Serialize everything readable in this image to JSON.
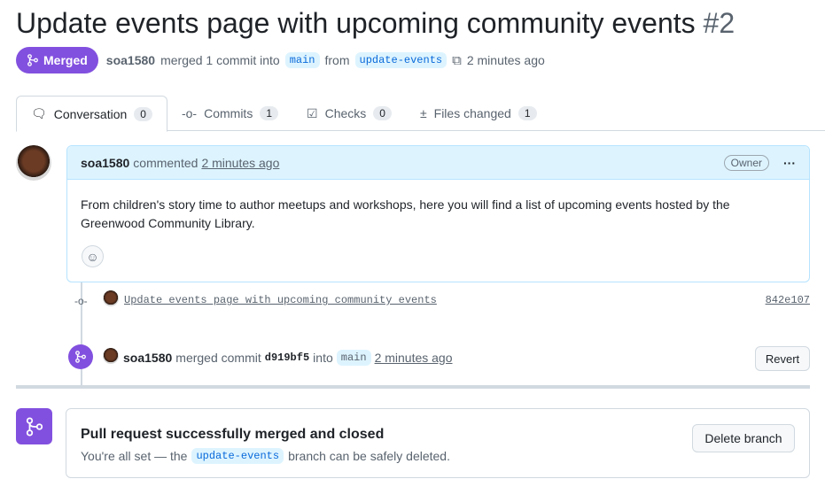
{
  "pr": {
    "title": "Update events page with upcoming community events",
    "number": "#2",
    "state": "Merged",
    "author": "soa1580",
    "summary": "merged 1 commit into",
    "base": "main",
    "from": "from",
    "head": "update-events",
    "time": "2 minutes ago"
  },
  "tabs": [
    {
      "label": "Conversation",
      "count": "0"
    },
    {
      "label": "Commits",
      "count": "1"
    },
    {
      "label": "Checks",
      "count": "0"
    },
    {
      "label": "Files changed",
      "count": "1"
    }
  ],
  "comment": {
    "author": "soa1580",
    "action": "commented",
    "time": "2 minutes ago",
    "role": "Owner",
    "body": "From children's story time to author meetups and workshops, here you will find a list of upcoming events hosted by the Greenwood Community Library."
  },
  "commit": {
    "message": "Update events page with upcoming community events",
    "sha": "842e107"
  },
  "merge_event": {
    "author": "soa1580",
    "action": "merged commit",
    "sha": "d919bf5",
    "into": "into",
    "base": "main",
    "time": "2 minutes ago",
    "revert": "Revert"
  },
  "status": {
    "title": "Pull request successfully merged and closed",
    "pre": "You're all set — the",
    "branch": "update-events",
    "post": "branch can be safely deleted.",
    "delete": "Delete branch"
  }
}
